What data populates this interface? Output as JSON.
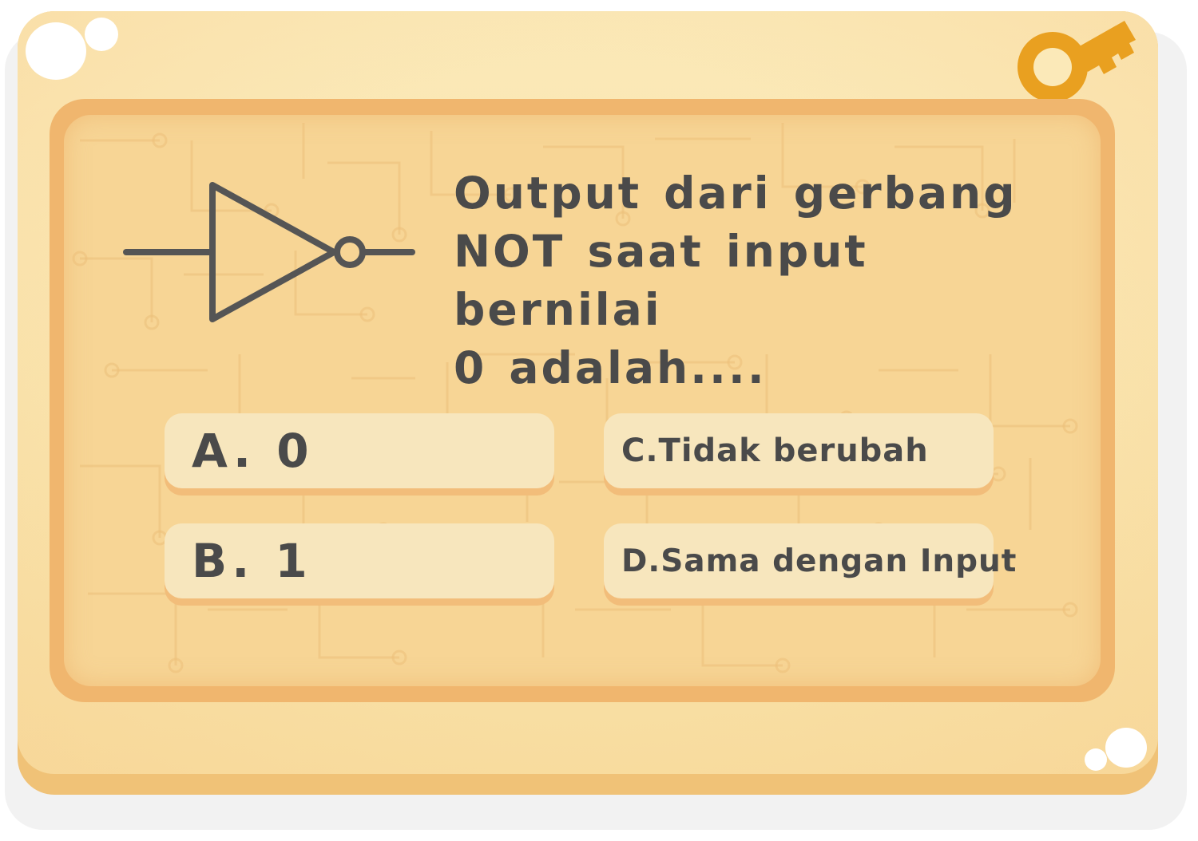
{
  "question": {
    "line1": "Output dari gerbang",
    "line2": "NOT saat input bernilai",
    "line3": "0 adalah...."
  },
  "options": {
    "a": "A. 0",
    "b": "B. 1",
    "c": "C.Tidak berubah",
    "d": "D.Sama dengan Input"
  },
  "colors": {
    "card": "#fbe9b8",
    "board": "#f0b66e",
    "board_inner": "#f7d595",
    "option_bg": "#f7e6bd",
    "option_shadow": "#f2bd7a",
    "text": "#4a4a4a",
    "key": "#e9a020"
  },
  "icons": {
    "gate": "not-gate-icon",
    "key": "key-icon"
  }
}
